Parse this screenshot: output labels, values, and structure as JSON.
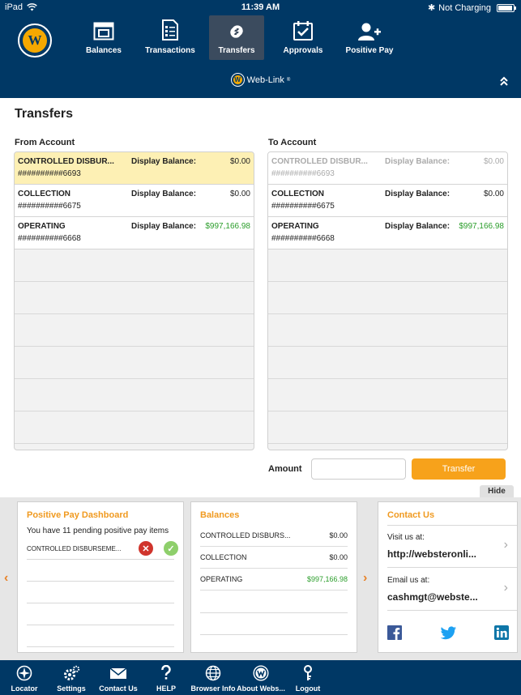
{
  "status_bar": {
    "device": "iPad",
    "time": "11:39 AM",
    "charging": "Not Charging"
  },
  "nav": {
    "items": [
      {
        "label": "Balances",
        "icon": "balances-icon"
      },
      {
        "label": "Transactions",
        "icon": "transactions-icon"
      },
      {
        "label": "Transfers",
        "icon": "transfers-icon",
        "active": true
      },
      {
        "label": "Approvals",
        "icon": "approvals-icon"
      },
      {
        "label": "Positive Pay",
        "icon": "add-user-icon"
      }
    ],
    "weblink_label": "Web-Link",
    "weblink_mark": "®"
  },
  "page": {
    "title": "Transfers",
    "from_label": "From Account",
    "to_label": "To Account"
  },
  "from_accounts": [
    {
      "name": "CONTROLLED DISBUR...",
      "number": "##########6693",
      "balance_label": "Display Balance:",
      "balance": "$0.00",
      "selected": true
    },
    {
      "name": "COLLECTION",
      "number": "##########6675",
      "balance_label": "Display Balance:",
      "balance": "$0.00"
    },
    {
      "name": "OPERATING",
      "number": "##########6668",
      "balance_label": "Display Balance:",
      "balance": "$997,166.98",
      "positive": true
    }
  ],
  "to_accounts": [
    {
      "name": "CONTROLLED DISBUR...",
      "number": "##########6693",
      "balance_label": "Display Balance:",
      "balance": "$0.00",
      "disabled": true
    },
    {
      "name": "COLLECTION",
      "number": "##########6675",
      "balance_label": "Display Balance:",
      "balance": "$0.00"
    },
    {
      "name": "OPERATING",
      "number": "##########6668",
      "balance_label": "Display Balance:",
      "balance": "$997,166.98",
      "positive": true
    }
  ],
  "transfer_form": {
    "amount_label": "Amount",
    "amount_value": "",
    "transfer_button": "Transfer",
    "hide_button": "Hide"
  },
  "positive_pay": {
    "title": "Positive Pay Dashboard",
    "message": "You have 11 pending positive pay items",
    "item": "CONTROLLED DISBURSEME...",
    "reject_glyph": "✕",
    "approve_glyph": "✓"
  },
  "balances_card": {
    "title": "Balances",
    "rows": [
      {
        "name": "CONTROLLED DISBURS...",
        "value": "$0.00"
      },
      {
        "name": "COLLECTION",
        "value": "$0.00"
      },
      {
        "name": "OPERATING",
        "value": "$997,166.98",
        "positive": true
      }
    ]
  },
  "contact": {
    "title": "Contact Us",
    "visit_label": "Visit us at:",
    "visit_value": "http://websteronli...",
    "email_label": "Email us at:",
    "email_value": "cashmgt@webste..."
  },
  "bottom_nav": [
    {
      "label": "Locator",
      "icon": "locator-icon"
    },
    {
      "label": "Settings",
      "icon": "settings-icon"
    },
    {
      "label": "Contact Us",
      "icon": "mail-icon"
    },
    {
      "label": "HELP",
      "icon": "help-icon"
    },
    {
      "label": "Browser Info",
      "icon": "globe-icon"
    },
    {
      "label": "About Webs...",
      "icon": "webster-logo-icon"
    },
    {
      "label": "Logout",
      "icon": "key-icon"
    }
  ],
  "colors": {
    "brand_navy": "#003865",
    "accent_orange": "#f7a21b",
    "positive_green": "#2a9d2a",
    "selected_row": "#fdf0b4"
  }
}
